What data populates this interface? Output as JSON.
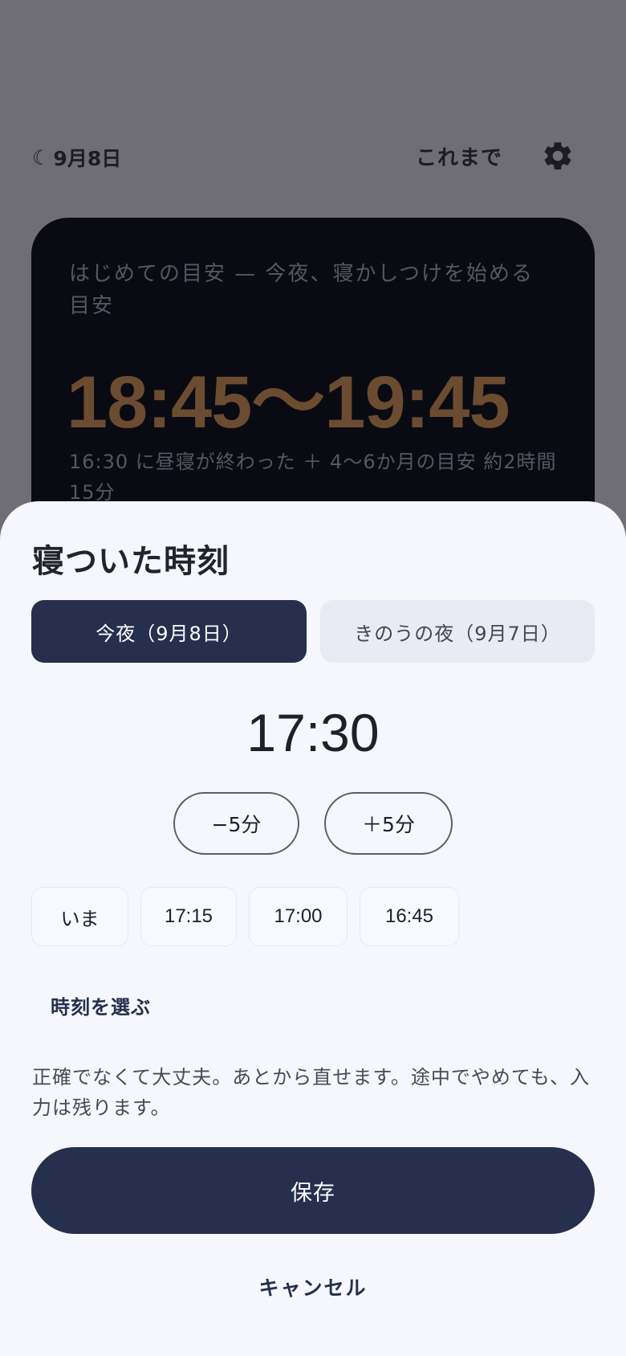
{
  "header": {
    "moon_icon": "☾",
    "date": "9月8日",
    "history_label": "これまで",
    "settings_icon": "gear-icon"
  },
  "guide_card": {
    "title": "はじめての目安 — 今夜、寝かしつけを始める目安",
    "range": "18:45〜19:45",
    "note": "16:30 に昼寝が終わった ＋ 4〜6か月の目安 約2時間15分"
  },
  "sheet": {
    "title": "寝ついた時刻",
    "segments": [
      {
        "label": "今夜（9月8日）",
        "selected": true
      },
      {
        "label": "きのうの夜（9月7日）",
        "selected": false
      }
    ],
    "time": "17:30",
    "minus_label": "−5分",
    "plus_label": "＋5分",
    "quick_chips": [
      "いま",
      "17:15",
      "17:00",
      "16:45"
    ],
    "pick_time_label": "時刻を選ぶ",
    "reassure_text": "正確でなくて大丈夫。あとから直せます。途中でやめても、入力は残ります。",
    "save_label": "保存",
    "cancel_label": "キャンセル"
  },
  "colors": {
    "overlay": "#6f6e74",
    "card_bg": "#0a0a13",
    "accent_orange": "#6b4c30",
    "primary_navy": "#262f4d",
    "sheet_bg": "#f5f7fd"
  }
}
